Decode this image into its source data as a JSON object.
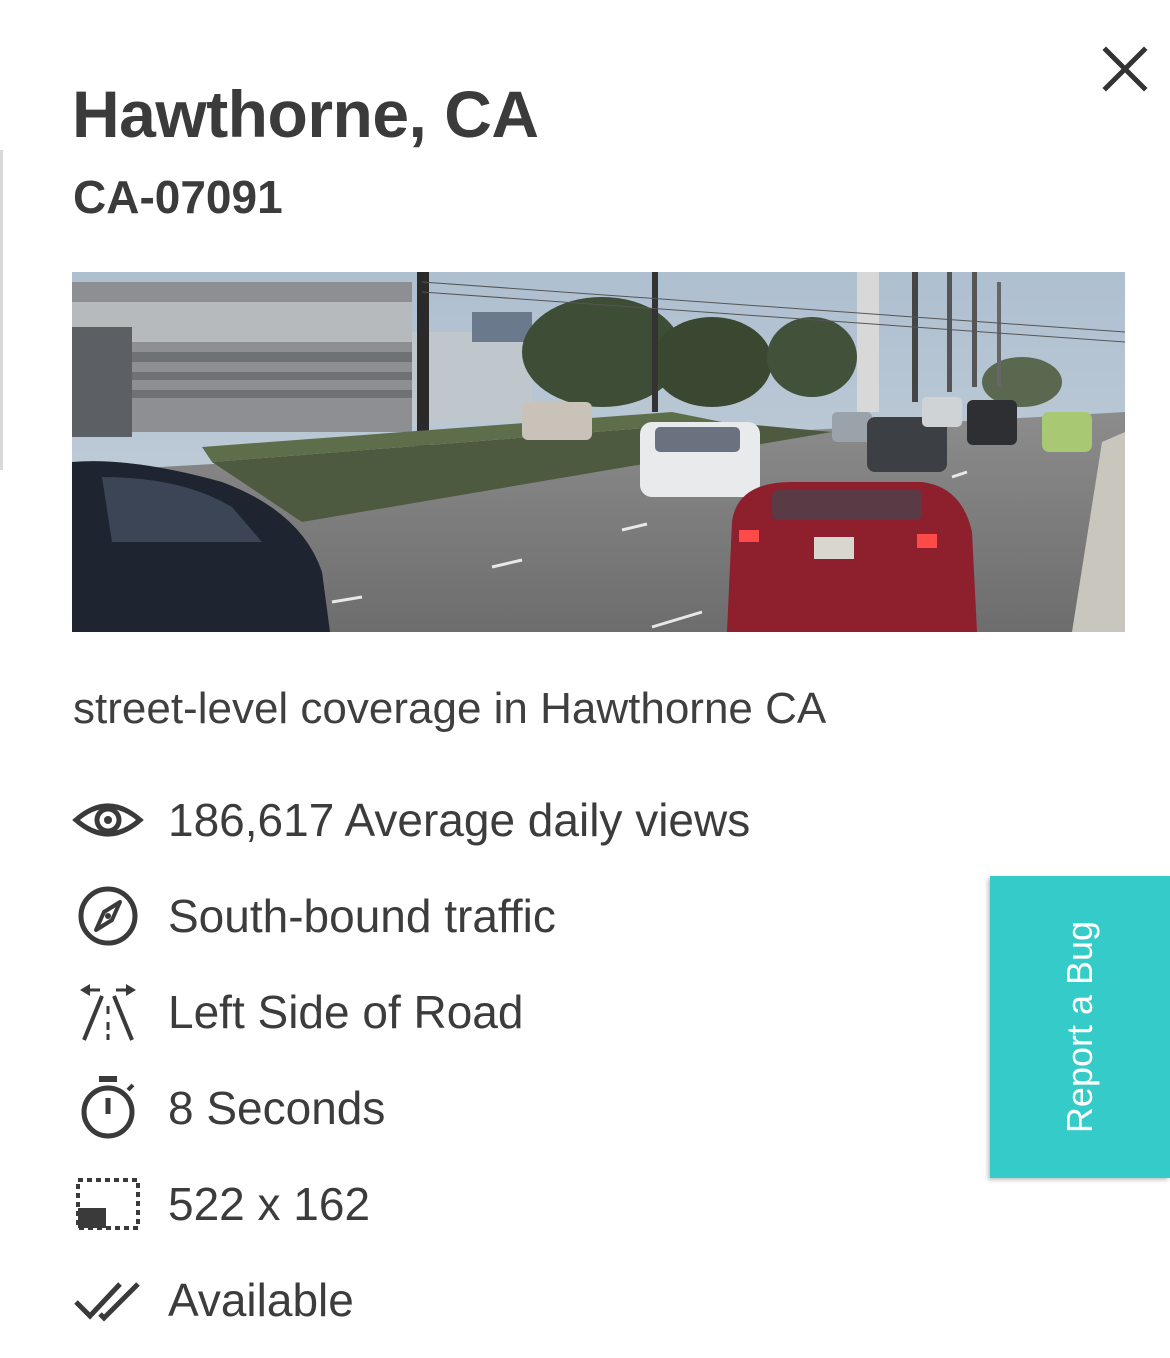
{
  "panel": {
    "title": "Hawthorne, CA",
    "code": "CA-07091",
    "photo_icon": "street-photo",
    "description": "street-level coverage in Hawthorne CA",
    "close_icon": "close-icon"
  },
  "details": [
    {
      "icon": "eye-icon",
      "text": "186,617 Average daily views"
    },
    {
      "icon": "compass-icon",
      "text": "South-bound traffic"
    },
    {
      "icon": "road-side-icon",
      "text": "Left Side of Road"
    },
    {
      "icon": "stopwatch-icon",
      "text": "8 Seconds"
    },
    {
      "icon": "dimensions-icon",
      "text": "522 x 162"
    },
    {
      "icon": "double-check-icon",
      "text": "Available"
    }
  ],
  "feedback": {
    "label": "Report a Bug",
    "color": "#35cbc8"
  }
}
